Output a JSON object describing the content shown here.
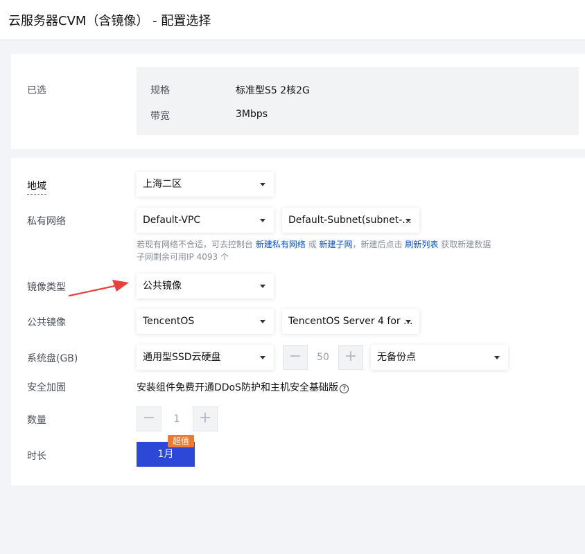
{
  "header": {
    "title": "云服务器CVM（含镜像） - 配置选择"
  },
  "selected": {
    "label": "已选",
    "items": [
      {
        "key": "规格",
        "value": "标准型S5 2核2G"
      },
      {
        "key": "带宽",
        "value": "3Mbps"
      }
    ]
  },
  "config": {
    "region": {
      "label": "地域",
      "value": "上海二区"
    },
    "network": {
      "label": "私有网络",
      "vpc": "Default-VPC",
      "subnet": "Default-Subnet(subnet-...",
      "hint_part1": "若现有网络不合适，可去控制台",
      "hint_link1": "新建私有网络",
      "hint_or": "或",
      "hint_link2": "新建子网",
      "hint_part2": "，新建后点击",
      "hint_link3": "刷新列表",
      "hint_part3": "获取新建数据",
      "hint_line2": "子网剩余可用IP 4093 个"
    },
    "image_type": {
      "label": "镜像类型",
      "value": "公共镜像"
    },
    "public_image": {
      "label": "公共镜像",
      "os": "TencentOS",
      "version": "TencentOS Server 4 for ..."
    },
    "system_disk": {
      "label": "系统盘(GB)",
      "type": "通用型SSD云硬盘",
      "size": "50",
      "minus": "−",
      "plus": "+",
      "backup": "无备份点"
    },
    "security": {
      "label": "安全加固",
      "text": "安装组件免费开通DDoS防护和主机安全基础版",
      "help": "?"
    },
    "quantity": {
      "label": "数量",
      "value": "1",
      "minus": "−",
      "plus": "+"
    },
    "duration": {
      "label": "时长",
      "option": "1月",
      "badge": "超值"
    }
  },
  "colors": {
    "accent": "#2b48d6",
    "link": "#0052d9",
    "badge": "#ed7b2f",
    "arrow": "#e8413c"
  }
}
